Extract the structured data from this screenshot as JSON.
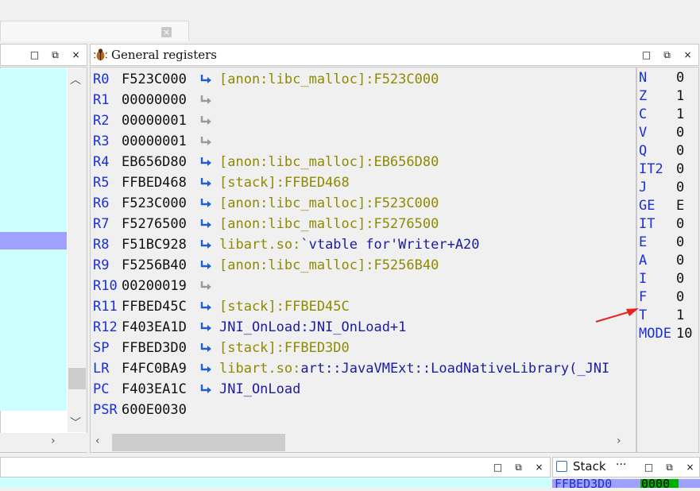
{
  "window_buttons": {
    "minimize": "□",
    "restore": "⧉",
    "close": "×"
  },
  "top_tab": {
    "close_glyph": "×"
  },
  "general_registers": {
    "title": "General registers",
    "registers": [
      {
        "name": "R0",
        "value": "F523C000",
        "annotation": "[anon:libc_malloc]:F523C000",
        "kind": "anon"
      },
      {
        "name": "R1",
        "value": "00000000",
        "annotation": "",
        "kind": "none"
      },
      {
        "name": "R2",
        "value": "00000001",
        "annotation": "",
        "kind": "none"
      },
      {
        "name": "R3",
        "value": "00000001",
        "annotation": "",
        "kind": "none"
      },
      {
        "name": "R4",
        "value": "EB656D80",
        "annotation": "[anon:libc_malloc]:EB656D80",
        "kind": "anon"
      },
      {
        "name": "R5",
        "value": "FFBED468",
        "annotation": "[stack]:FFBED468",
        "kind": "anon"
      },
      {
        "name": "R6",
        "value": "F523C000",
        "annotation": "[anon:libc_malloc]:F523C000",
        "kind": "anon"
      },
      {
        "name": "R7",
        "value": "F5276500",
        "annotation": "[anon:libc_malloc]:F5276500",
        "kind": "anon"
      },
      {
        "name": "R8",
        "value": "F51BC928",
        "annotation_lib": "libart.so:",
        "annotation_sym": "`vtable for'Writer+A20",
        "kind": "lib"
      },
      {
        "name": "R9",
        "value": "F5256B40",
        "annotation": "[anon:libc_malloc]:F5256B40",
        "kind": "anon"
      },
      {
        "name": "R10",
        "value": "00200019",
        "annotation": "",
        "kind": "none"
      },
      {
        "name": "R11",
        "value": "FFBED45C",
        "annotation": "[stack]:FFBED45C",
        "kind": "anon"
      },
      {
        "name": "R12",
        "value": "F403EA1D",
        "annotation": "JNI_OnLoad:JNI_OnLoad+1",
        "kind": "sym"
      },
      {
        "name": "SP",
        "value": "FFBED3D0",
        "annotation": "[stack]:FFBED3D0",
        "kind": "anon"
      },
      {
        "name": "LR",
        "value": "F4FC0BA9",
        "annotation_lib": "libart.so:",
        "annotation_sym": "art::JavaVMExt::LoadNativeLibrary(_JNI",
        "kind": "lib"
      },
      {
        "name": "PC",
        "value": "F403EA1C",
        "annotation": "JNI_OnLoad",
        "kind": "sym"
      },
      {
        "name": "PSR",
        "value": "600E0030",
        "annotation": "",
        "kind": "noarrow"
      }
    ]
  },
  "flags": [
    {
      "name": "N",
      "value": "0"
    },
    {
      "name": "Z",
      "value": "1"
    },
    {
      "name": "C",
      "value": "1"
    },
    {
      "name": "V",
      "value": "0"
    },
    {
      "name": "Q",
      "value": "0"
    },
    {
      "name": "IT2",
      "value": "0"
    },
    {
      "name": "J",
      "value": "0"
    },
    {
      "name": "GE",
      "value": "E"
    },
    {
      "name": "IT",
      "value": "0"
    },
    {
      "name": "E",
      "value": "0"
    },
    {
      "name": "A",
      "value": "0"
    },
    {
      "name": "I",
      "value": "0"
    },
    {
      "name": "F",
      "value": "0"
    },
    {
      "name": "T",
      "value": "1"
    },
    {
      "name": "MODE",
      "value": "10"
    }
  ],
  "stack": {
    "title": "Stack",
    "more": "···",
    "first_row_address": "FFBED3D0",
    "first_row_value": "0000"
  },
  "colors": {
    "register_name": "#1a2fd8",
    "annotation_anon": "#8f8a00",
    "annotation_sym": "#1c1c9e",
    "highlight_cyan": "#ccffff",
    "highlight_selection": "#a0a0ff",
    "annotation_arrow": "#e8231e"
  }
}
